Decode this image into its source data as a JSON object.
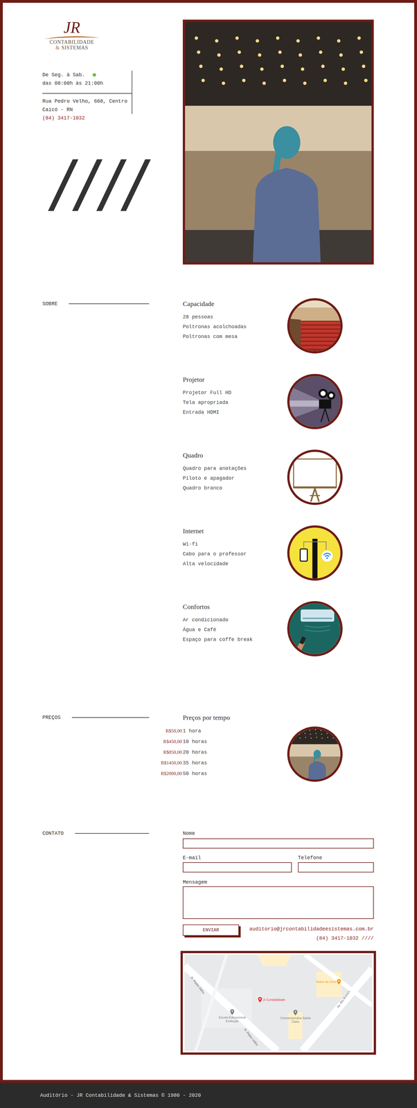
{
  "logo": {
    "monogram": "JR",
    "line1": "CONTABILIDADE",
    "amp": "&",
    "line2": "SISTEMAS"
  },
  "hours": {
    "days": "De Seg. à Sab.",
    "open": true,
    "time": "das 08:00h às 21:00h"
  },
  "address": {
    "street": "Rua Pedro Velho, 668, Centro",
    "city": "Caicó - RN",
    "phone": "(84) 3417-1032"
  },
  "about": {
    "label": "SOBRE",
    "features": [
      {
        "title": "Capacidade",
        "items": [
          "28 pessoas",
          "Poltronas acolchoadas",
          "Poltronas com mesa"
        ]
      },
      {
        "title": "Projetor",
        "items": [
          "Projetor Full HD",
          "Tela apropriada",
          "Entrada HDMI"
        ]
      },
      {
        "title": "Quadro",
        "items": [
          "Quadro para anotações",
          "Piloto e apagador",
          "Quadro branco"
        ]
      },
      {
        "title": "Internet",
        "items": [
          "Wi-fi",
          "Cabo para o professor",
          "Alta velocidade"
        ]
      },
      {
        "title": "Confortos",
        "items": [
          "Ar condicionado",
          "Água e Café",
          "Espaço para coffe break"
        ]
      }
    ]
  },
  "prices": {
    "label": "PREÇOS",
    "title": "Preços por tempo",
    "rows": [
      {
        "price": "R$50,00",
        "duration": "1 hora"
      },
      {
        "price": "R$450,00",
        "duration": "10 horas"
      },
      {
        "price": "R$850,00",
        "duration": "20 horas"
      },
      {
        "price": "R$1450,00",
        "duration": "35 horas"
      },
      {
        "price": "R$2000,00",
        "duration": "50 horas"
      }
    ]
  },
  "contact": {
    "label": "CONTATO",
    "fields": {
      "name": "Nome",
      "email": "E-mail",
      "phone": "Telefone",
      "message": "Mensagem"
    },
    "button": "ENVIAR",
    "email": "auditorio@jrcontabilidadeesistemas.com.br",
    "phone": "(84) 3417-1032 ////"
  },
  "map": {
    "streets": [
      "R. Pedro Velho",
      "R. Pedro Velho",
      "Av. Rio Branco"
    ],
    "places": [
      {
        "name": "Jr Contabilidade",
        "color": "#e53935"
      },
      {
        "name": "Bolos da Vovó",
        "color": "#f29900"
      },
      {
        "name": "Escola Educacional Evolução",
        "color": "#7a7a7a"
      },
      {
        "name": "Concessionária Santa Clara",
        "color": "#7a7a7a"
      }
    ]
  },
  "footer": "Auditório - JR Contabilidade & Sistemas © 1980 - 2020"
}
